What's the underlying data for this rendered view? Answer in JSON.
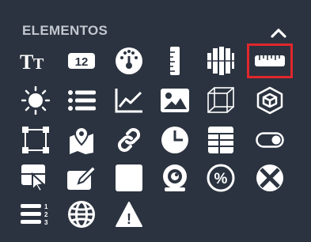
{
  "panel": {
    "title": "ELEMENTOS",
    "collapse_icon": "chevron-up-icon",
    "selected": "ruler-horizontal",
    "colors": {
      "background": "#2b3340",
      "icon": "#ffffff",
      "title": "#c3c7cf",
      "selection": "#e0272c"
    }
  },
  "elements": [
    {
      "name": "text",
      "icon": "text-size-icon"
    },
    {
      "name": "number",
      "icon": "number-12-icon",
      "label": "12"
    },
    {
      "name": "gauge",
      "icon": "gauge-icon"
    },
    {
      "name": "ruler-vertical",
      "icon": "ruler-vertical-icon"
    },
    {
      "name": "bar-columns",
      "icon": "columns-icon"
    },
    {
      "name": "ruler-horizontal",
      "icon": "ruler-horizontal-icon"
    },
    {
      "name": "brightness",
      "icon": "sun-icon"
    },
    {
      "name": "list",
      "icon": "list-icon"
    },
    {
      "name": "line-chart",
      "icon": "line-chart-icon"
    },
    {
      "name": "image",
      "icon": "image-icon"
    },
    {
      "name": "cube",
      "icon": "cube-icon"
    },
    {
      "name": "3d-object",
      "icon": "3d-cube-icon"
    },
    {
      "name": "frame",
      "icon": "vector-frame-icon"
    },
    {
      "name": "map",
      "icon": "map-pin-icon"
    },
    {
      "name": "link",
      "icon": "link-icon"
    },
    {
      "name": "clock",
      "icon": "clock-icon"
    },
    {
      "name": "table",
      "icon": "table-icon"
    },
    {
      "name": "toggle",
      "icon": "toggle-icon"
    },
    {
      "name": "pointer",
      "icon": "cursor-window-icon"
    },
    {
      "name": "edit",
      "icon": "edit-icon"
    },
    {
      "name": "square",
      "icon": "square-icon"
    },
    {
      "name": "webcam",
      "icon": "webcam-icon"
    },
    {
      "name": "percent",
      "icon": "percent-icon",
      "label": "%"
    },
    {
      "name": "close",
      "icon": "x-circle-icon"
    },
    {
      "name": "numbered-list",
      "icon": "numbered-list-icon",
      "labels": [
        "1",
        "2",
        "3"
      ]
    },
    {
      "name": "web",
      "icon": "globe-icon"
    },
    {
      "name": "warning",
      "icon": "warning-icon",
      "label": "!"
    }
  ]
}
